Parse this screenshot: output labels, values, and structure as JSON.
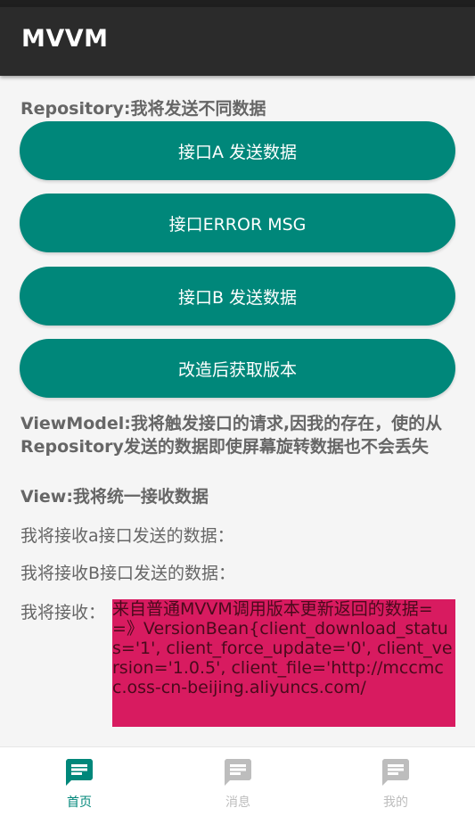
{
  "app": {
    "title": "MVVM"
  },
  "repository": {
    "heading": "Repository:我将发送不同数据"
  },
  "buttons": {
    "api_a": "接口A 发送数据",
    "api_error": "接口ERROR MSG",
    "api_b": "接口B 发送数据",
    "get_version": "改造后获取版本"
  },
  "viewmodel": {
    "line1": "ViewModel:我将触发接口的请求,因我的存在，使的从",
    "line2": "Repository发送的数据即使屏幕旋转数据也不会丢失"
  },
  "view": {
    "heading": "View:我将统一接收数据",
    "receive_a": "我将接收a接口发送的数据：",
    "receive_b": "我将接收B接口发送的数据：",
    "receive_label": "我将接收：",
    "receive_value": "来自普通MVVM调用版本更新返回的数据==》VersionBean{client_download_status='1', client_force_update='0', client_version='1.0.5', client_file='http://mccmcc.oss-cn-beijing.aliyuncs.com/"
  },
  "nav": {
    "items": [
      {
        "label": "首页",
        "icon": "message-icon",
        "active": true
      },
      {
        "label": "消息",
        "icon": "message-icon",
        "active": false
      },
      {
        "label": "我的",
        "icon": "message-icon",
        "active": false
      }
    ]
  },
  "colors": {
    "primary": "#00877a",
    "appbar": "#2b2b2b",
    "accent_box": "#d81b60",
    "nav_active": "#00877a",
    "nav_inactive": "#bdbdbd"
  }
}
